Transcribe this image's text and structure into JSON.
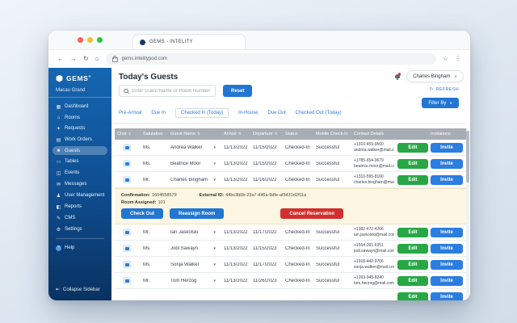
{
  "browser": {
    "tab_title": "GEMS - INTELITY",
    "url": "gems.intelitypod.com",
    "traffic_lights": [
      "#ff5f57",
      "#febc2e",
      "#28c840"
    ]
  },
  "sidebar": {
    "logo_text": "GEMS",
    "logo_mark": "®",
    "property": "Macau Grand",
    "items": [
      {
        "label": "Dashboard",
        "icon": "dashboard-icon",
        "glyph": "▦"
      },
      {
        "label": "Rooms",
        "icon": "rooms-icon",
        "glyph": "⌂"
      },
      {
        "label": "Requests",
        "icon": "requests-icon",
        "glyph": "✦"
      },
      {
        "label": "Work Orders",
        "icon": "work-orders-icon",
        "glyph": "▤"
      },
      {
        "label": "Guests",
        "icon": "guests-icon",
        "glyph": "☻",
        "active": true
      },
      {
        "label": "Tables",
        "icon": "tables-icon",
        "glyph": "▭"
      },
      {
        "label": "Events",
        "icon": "events-icon",
        "glyph": "◫"
      },
      {
        "label": "Messages",
        "icon": "messages-icon",
        "glyph": "✉"
      },
      {
        "label": "User Management",
        "icon": "user-management-icon",
        "glyph": "♟"
      },
      {
        "label": "Reports",
        "icon": "reports-icon",
        "glyph": "◧"
      },
      {
        "label": "CMS",
        "icon": "cms-icon",
        "glyph": "✎"
      },
      {
        "label": "Settings",
        "icon": "settings-icon",
        "glyph": "⚙"
      }
    ],
    "help_label": "Help",
    "collapse_label": "Collapse Sidebar"
  },
  "header": {
    "title": "Today's Guests",
    "user_name": "Charles Bingham",
    "search_placeholder": "Enter Guest Name or Room Number",
    "reset_label": "Reset",
    "refresh_label": "REFRESH",
    "filter_label": "Filter By"
  },
  "tabs": [
    {
      "label": "Pre-Arrival"
    },
    {
      "label": "Due In"
    },
    {
      "label": "Checked In (Today)",
      "active": true
    },
    {
      "label": "In-House"
    },
    {
      "label": "Due Out"
    },
    {
      "label": "Checked Out (Today)"
    }
  ],
  "table": {
    "columns": [
      {
        "label": "Chat",
        "sort": "caret"
      },
      {
        "label": "Salutation",
        "sort": null
      },
      {
        "label": "Guest Name",
        "sort": "updown"
      },
      {
        "label": "Arrival",
        "sort": "updown"
      },
      {
        "label": "Departure",
        "sort": "updown"
      },
      {
        "label": "Status",
        "sort": null
      },
      {
        "label": "Mobile Check-In",
        "sort": null
      },
      {
        "label": "Contact Details",
        "sort": null
      },
      {
        "label": "Invitations",
        "sort": null
      }
    ],
    "edit_label": "Edit",
    "invite_label": "Invite",
    "rows": [
      {
        "salutation": "Ms.",
        "name": "Andrea Walker",
        "arrival": "11/13/2022",
        "departure": "11/15/2022",
        "status": "Checked-In",
        "mobile_checkin": "Successful",
        "phone": "+1310-459-9560",
        "email": "andrea.walker@mail.com"
      },
      {
        "salutation": "Ms.",
        "name": "Beatrice Moor",
        "arrival": "11/13/2022",
        "departure": "11/15/2022",
        "status": "Checked-In",
        "mobile_checkin": "Successful",
        "phone": "+1785-654-9679",
        "email": "beatrice.moor@mail.com"
      },
      {
        "salutation": "Mr.",
        "name": "Charles Bingham",
        "arrival": "11/13/2022",
        "departure": "11/16/2022",
        "status": "Checked-In",
        "mobile_checkin": "Successful",
        "phone": "+1310-595-8160",
        "email": "charles.bingham@mail.com",
        "expanded": true
      },
      {
        "salutation": "Mr.",
        "name": "Ian Jaskolski",
        "arrival": "11/13/2022",
        "departure": "11/17/2022",
        "status": "Checked-In",
        "mobile_checkin": "Successful",
        "phone": "+1382-472-4266",
        "email": "ian.jaskolski@mail.com"
      },
      {
        "salutation": "Ms.",
        "name": "Jodi Sawayn",
        "arrival": "11/13/2022",
        "departure": "11/15/2023",
        "status": "Checked-In",
        "mobile_checkin": "Successful",
        "phone": "+1554-391-6351",
        "email": "jodi.sawayn@mail.com"
      },
      {
        "salutation": "Ms.",
        "name": "Sonja Walker",
        "arrival": "11/13/2022",
        "departure": "11/17/2022",
        "status": "Checked-In",
        "mobile_checkin": "Successful",
        "phone": "+1918-442-9706",
        "email": "sonja.walker@mail.com"
      },
      {
        "salutation": "Mr.",
        "name": "Tom Herzog",
        "arrival": "11/13/2022",
        "departure": "11/26/2023",
        "status": "Checked-In",
        "mobile_checkin": "Successful",
        "phone": "+1269-948-8240",
        "email": "tom.herzog@mail.com"
      },
      {
        "salutation": "",
        "name": "",
        "arrival": "",
        "departure": "",
        "status": "",
        "mobile_checkin": "",
        "phone": "",
        "email": "",
        "partial": true
      }
    ],
    "expanded_panel": {
      "confirmation_label": "Confirmation:",
      "confirmation": "1604558579",
      "external_id_label": "External ID:",
      "external_id": "44bc3b0b-23a7-446a-9dfe-af3431d2f11a",
      "room_label": "Room Assigned:",
      "room": "101",
      "check_out_label": "Check Out",
      "reassign_label": "Reassign Room",
      "cancel_label": "Cancel Reservation"
    }
  },
  "colors": {
    "sidebar_top": "#1566b1",
    "sidebar_bottom": "#093261",
    "accent_blue": "#2176d2",
    "edit_green": "#27a844",
    "cancel_red": "#d22f2f",
    "panel_yellow": "#fcf6e2",
    "table_header_gray": "#a7adb4"
  }
}
